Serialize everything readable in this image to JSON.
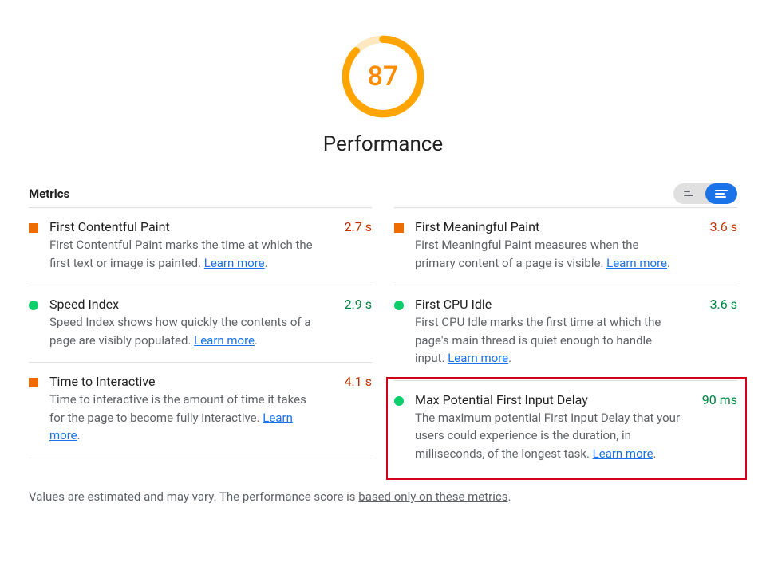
{
  "gauge": {
    "score": "87",
    "score_num": 87,
    "title": "Performance",
    "ring_color": "#ffa400",
    "ring_bg": "#ffe8bf"
  },
  "metrics_header": "Metrics",
  "learn_more": "Learn more",
  "colors": {
    "orange": "#ef6c00",
    "green": "#0cce6b",
    "value_orange": "#c33300",
    "value_green": "#018642",
    "highlight": "#d0021b"
  },
  "left_metrics": [
    {
      "title": "First Contentful Paint",
      "desc": "First Contentful Paint marks the time at which the first text or image is painted. ",
      "value": "2.7 s",
      "status": "orange"
    },
    {
      "title": "Speed Index",
      "desc": "Speed Index shows how quickly the contents of a page are visibly populated. ",
      "value": "2.9 s",
      "status": "green"
    },
    {
      "title": "Time to Interactive",
      "desc": "Time to interactive is the amount of time it takes for the page to become fully interactive. ",
      "value": "4.1 s",
      "status": "orange"
    }
  ],
  "right_metrics": [
    {
      "title": "First Meaningful Paint",
      "desc": "First Meaningful Paint measures when the primary content of a page is visible. ",
      "value": "3.6 s",
      "status": "orange"
    },
    {
      "title": "First CPU Idle",
      "desc": "First CPU Idle marks the first time at which the page's main thread is quiet enough to handle input. ",
      "value": "3.6 s",
      "status": "green"
    },
    {
      "title": "Max Potential First Input Delay",
      "desc": "The maximum potential First Input Delay that your users could experience is the duration, in milliseconds, of the longest task. ",
      "value": "90 ms",
      "status": "green",
      "highlighted": true
    }
  ],
  "footnote_pre": "Values are estimated and may vary. The performance score is ",
  "footnote_link": "based only on these metrics",
  "footnote_post": "."
}
